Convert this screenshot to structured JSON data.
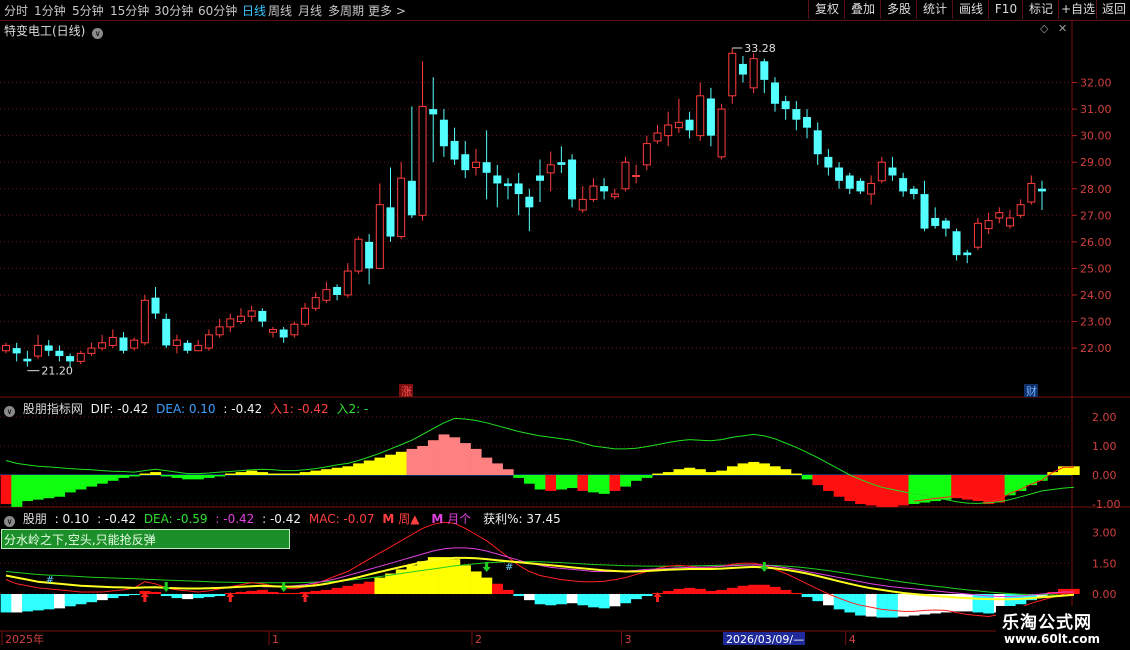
{
  "toolbar": {
    "left_tabs": [
      {
        "label": "分时"
      },
      {
        "label": "1分钟"
      },
      {
        "label": "5分钟"
      },
      {
        "label": "15分钟"
      },
      {
        "label": "30分钟"
      },
      {
        "label": "60分钟"
      },
      {
        "label": "日线",
        "active": true
      },
      {
        "label": "周线"
      },
      {
        "label": "月线"
      },
      {
        "label": "多周期"
      },
      {
        "label": "更多 >"
      }
    ],
    "right_buttons": [
      {
        "label": "复权"
      },
      {
        "label": "叠加"
      },
      {
        "label": "多股"
      },
      {
        "label": "统计"
      },
      {
        "label": "画线"
      },
      {
        "label": "F10"
      },
      {
        "label": "标记"
      },
      {
        "label": "+自选"
      },
      {
        "label": "返回"
      }
    ]
  },
  "main_chart": {
    "title": "特变电工(日线)",
    "y_ticks": [
      "32.00",
      "31.00",
      "30.00",
      "29.00",
      "28.00",
      "27.00",
      "26.00",
      "25.00",
      "24.00",
      "23.00",
      "22.00"
    ],
    "high_label": "33.28",
    "low_label": "21.20",
    "marker_up": "涨",
    "marker_fin": "财",
    "candles": [
      [
        21.9,
        22.1,
        21.8,
        22.2
      ],
      [
        22.0,
        21.8,
        21.5,
        22.2
      ],
      [
        21.6,
        21.5,
        21.3,
        21.9
      ],
      [
        21.7,
        22.1,
        21.6,
        22.5
      ],
      [
        22.1,
        21.9,
        21.7,
        22.3
      ],
      [
        21.9,
        21.7,
        21.5,
        22.1
      ],
      [
        21.7,
        21.5,
        21.3,
        21.8
      ],
      [
        21.5,
        21.8,
        21.4,
        21.9
      ],
      [
        21.8,
        22.0,
        21.7,
        22.2
      ],
      [
        22.0,
        22.2,
        21.9,
        22.5
      ],
      [
        22.1,
        22.4,
        22.0,
        22.7
      ],
      [
        22.4,
        21.9,
        21.8,
        22.6
      ],
      [
        22.0,
        22.3,
        21.9,
        22.4
      ],
      [
        22.2,
        23.8,
        22.1,
        24.0
      ],
      [
        23.9,
        23.3,
        23.1,
        24.3
      ],
      [
        23.1,
        22.1,
        22.0,
        23.3
      ],
      [
        22.1,
        22.3,
        21.8,
        22.5
      ],
      [
        22.2,
        21.9,
        21.8,
        22.3
      ],
      [
        21.9,
        22.1,
        21.9,
        22.3
      ],
      [
        22.0,
        22.5,
        21.9,
        22.7
      ],
      [
        22.5,
        22.8,
        22.4,
        23.1
      ],
      [
        22.8,
        23.1,
        22.6,
        23.3
      ],
      [
        23.0,
        23.2,
        22.9,
        23.5
      ],
      [
        23.2,
        23.4,
        23.0,
        23.6
      ],
      [
        23.4,
        23.0,
        22.8,
        23.5
      ],
      [
        22.6,
        22.7,
        22.4,
        22.8
      ],
      [
        22.7,
        22.4,
        22.2,
        22.8
      ],
      [
        22.5,
        22.9,
        22.4,
        23.0
      ],
      [
        22.9,
        23.5,
        22.8,
        23.7
      ],
      [
        23.5,
        23.9,
        23.4,
        24.1
      ],
      [
        23.8,
        24.2,
        23.7,
        24.5
      ],
      [
        24.3,
        24.0,
        23.8,
        24.4
      ],
      [
        24.0,
        24.9,
        23.9,
        25.2
      ],
      [
        24.9,
        26.1,
        24.8,
        26.2
      ],
      [
        26.0,
        25.0,
        24.4,
        26.3
      ],
      [
        25.0,
        27.4,
        25.0,
        28.2
      ],
      [
        27.3,
        26.2,
        26.0,
        28.8
      ],
      [
        26.2,
        28.4,
        26.1,
        29.0
      ],
      [
        28.3,
        27.0,
        26.9,
        31.1
      ],
      [
        27.0,
        31.1,
        26.8,
        32.8
      ],
      [
        31.0,
        30.8,
        29.0,
        32.2
      ],
      [
        30.6,
        29.6,
        29.2,
        31.0
      ],
      [
        29.8,
        29.1,
        28.9,
        30.3
      ],
      [
        29.3,
        28.7,
        28.4,
        29.8
      ],
      [
        28.8,
        29.0,
        28.5,
        29.5
      ],
      [
        29.0,
        28.6,
        27.6,
        30.2
      ],
      [
        28.5,
        28.2,
        27.3,
        28.9
      ],
      [
        28.2,
        28.1,
        27.6,
        28.4
      ],
      [
        28.2,
        27.8,
        27.0,
        28.6
      ],
      [
        27.7,
        27.3,
        26.4,
        28.0
      ],
      [
        28.5,
        28.3,
        27.5,
        29.1
      ],
      [
        28.6,
        28.9,
        27.9,
        29.4
      ],
      [
        29.0,
        28.9,
        28.6,
        29.6
      ],
      [
        29.1,
        27.6,
        27.3,
        29.3
      ],
      [
        27.2,
        27.6,
        27.1,
        28.1
      ],
      [
        27.6,
        28.1,
        27.5,
        28.4
      ],
      [
        28.1,
        27.9,
        27.6,
        28.4
      ],
      [
        27.7,
        27.8,
        27.6,
        28.0
      ],
      [
        28.0,
        29.0,
        27.9,
        29.2
      ],
      [
        28.5,
        28.5,
        28.2,
        28.9
      ],
      [
        28.9,
        29.7,
        28.7,
        30.0
      ],
      [
        29.8,
        30.1,
        29.7,
        30.4
      ],
      [
        30.0,
        30.4,
        29.6,
        30.9
      ],
      [
        30.3,
        30.5,
        30.1,
        31.4
      ],
      [
        30.6,
        30.2,
        29.9,
        30.9
      ],
      [
        30.0,
        31.5,
        29.8,
        32.0
      ],
      [
        31.4,
        30.0,
        29.6,
        31.8
      ],
      [
        29.2,
        31.0,
        29.1,
        31.2
      ],
      [
        31.5,
        33.1,
        31.2,
        33.3
      ],
      [
        32.7,
        32.3,
        32.0,
        33.0
      ],
      [
        31.8,
        32.9,
        31.6,
        33.1
      ],
      [
        32.8,
        32.1,
        31.6,
        32.9
      ],
      [
        32.0,
        31.2,
        30.9,
        32.2
      ],
      [
        31.3,
        31.0,
        30.6,
        31.5
      ],
      [
        31.0,
        30.6,
        30.2,
        31.3
      ],
      [
        30.7,
        30.3,
        29.9,
        31.0
      ],
      [
        30.2,
        29.3,
        28.9,
        30.5
      ],
      [
        29.2,
        28.8,
        28.5,
        29.5
      ],
      [
        28.8,
        28.3,
        28.0,
        29.0
      ],
      [
        28.5,
        28.0,
        27.8,
        28.6
      ],
      [
        28.3,
        27.9,
        27.8,
        28.4
      ],
      [
        27.8,
        28.2,
        27.4,
        28.5
      ],
      [
        28.3,
        29.0,
        28.2,
        29.2
      ],
      [
        28.8,
        28.5,
        28.3,
        29.2
      ],
      [
        28.4,
        27.9,
        27.7,
        28.6
      ],
      [
        28.0,
        27.8,
        27.6,
        28.1
      ],
      [
        27.8,
        26.5,
        26.4,
        28.3
      ],
      [
        26.9,
        26.6,
        26.5,
        27.3
      ],
      [
        26.8,
        26.5,
        26.2,
        26.9
      ],
      [
        26.4,
        25.5,
        25.3,
        26.5
      ],
      [
        25.6,
        25.5,
        25.2,
        25.7
      ],
      [
        25.8,
        26.7,
        25.7,
        26.9
      ],
      [
        26.5,
        26.8,
        26.3,
        27.1
      ],
      [
        26.9,
        27.1,
        26.7,
        27.3
      ],
      [
        26.6,
        26.9,
        26.5,
        27.2
      ],
      [
        27.0,
        27.4,
        26.9,
        27.6
      ],
      [
        27.5,
        28.2,
        27.4,
        28.5
      ],
      [
        28.0,
        27.9,
        27.2,
        28.3
      ]
    ]
  },
  "macd_panel": {
    "name": "股朋指标网",
    "dif": "DIF: -0.42",
    "dea": "DEA: 0.10",
    "v3": ": -0.42",
    "in1": "入1: -0.42",
    "in2": "入2: -",
    "y_ticks": [
      "2.00",
      "1.00",
      "0.00",
      "-1.00"
    ],
    "hist": [
      -1.0,
      -1.1,
      -0.9,
      -0.85,
      -0.8,
      -0.75,
      -0.6,
      -0.5,
      -0.4,
      -0.3,
      -0.2,
      -0.1,
      -0.05,
      0.05,
      0.1,
      -0.05,
      -0.1,
      -0.15,
      -0.15,
      -0.1,
      -0.05,
      0.05,
      0.1,
      0.15,
      0.1,
      0.05,
      0.05,
      0.05,
      0.1,
      0.15,
      0.2,
      0.25,
      0.3,
      0.4,
      0.5,
      0.6,
      0.7,
      0.8,
      0.9,
      1.0,
      1.2,
      1.4,
      1.3,
      1.1,
      0.9,
      0.6,
      0.4,
      0.2,
      -0.1,
      -0.3,
      -0.5,
      -0.55,
      -0.5,
      -0.45,
      -0.55,
      -0.6,
      -0.65,
      -0.55,
      -0.4,
      -0.2,
      -0.1,
      0.05,
      0.1,
      0.2,
      0.25,
      0.2,
      0.1,
      0.15,
      0.3,
      0.4,
      0.45,
      0.4,
      0.3,
      0.2,
      0.05,
      -0.15,
      -0.35,
      -0.55,
      -0.75,
      -0.9,
      -1.0,
      -1.05,
      -1.1,
      -1.1,
      -1.05,
      -1.0,
      -0.95,
      -0.9,
      -0.85,
      -0.8,
      -0.85,
      -0.9,
      -1.0,
      -0.95,
      -0.7,
      -0.55,
      -0.35,
      -0.2,
      0.1,
      0.3,
      0.3
    ],
    "dif_line": [
      0.5,
      0.4,
      0.35,
      0.3,
      0.28,
      0.25,
      0.22,
      0.2,
      0.18,
      0.15,
      0.13,
      0.12,
      0.1,
      0.15,
      0.2,
      0.15,
      0.1,
      0.05,
      0.05,
      0.07,
      0.1,
      0.12,
      0.15,
      0.18,
      0.2,
      0.18,
      0.15,
      0.15,
      0.18,
      0.22,
      0.28,
      0.35,
      0.4,
      0.5,
      0.62,
      0.75,
      0.9,
      1.05,
      1.2,
      1.4,
      1.6,
      1.8,
      1.95,
      1.93,
      1.88,
      1.8,
      1.7,
      1.6,
      1.5,
      1.42,
      1.35,
      1.3,
      1.25,
      1.2,
      1.1,
      1.0,
      0.95,
      0.9,
      0.9,
      0.92,
      0.98,
      1.05,
      1.12,
      1.18,
      1.22,
      1.2,
      1.18,
      1.22,
      1.3,
      1.35,
      1.4,
      1.35,
      1.25,
      1.1,
      0.95,
      0.78,
      0.6,
      0.4,
      0.2,
      0.0,
      -0.15,
      -0.3,
      -0.42,
      -0.5,
      -0.58,
      -0.65,
      -0.7,
      -0.78,
      -0.85,
      -0.92,
      -0.97,
      -0.98,
      -0.96,
      -0.92,
      -0.85,
      -0.75,
      -0.65,
      -0.55,
      -0.5,
      -0.45,
      -0.42
    ],
    "dea_line": [
      0.05,
      0.05,
      0.05,
      0.05,
      0.05,
      0.05,
      0.05,
      0.05,
      0.05,
      0.05,
      0.05,
      0.05,
      0.05,
      0.05,
      0.05,
      0.05,
      0.05,
      0.05,
      0.05,
      0.05,
      0.05,
      0.05,
      0.05,
      0.05,
      0.05,
      0.05,
      0.05,
      0.05,
      0.05,
      0.05,
      0.05,
      0.05,
      0.05,
      0.05,
      0.05,
      0.05,
      0.05,
      0.05,
      0.05,
      0.05,
      0.05,
      0.05,
      0.05,
      0.05,
      0.05,
      0.05,
      0.05,
      0.05,
      0.05,
      0.05,
      0.05,
      0.05,
      0.05,
      0.05,
      0.05,
      0.05,
      0.05,
      0.05,
      0.05,
      0.05,
      0.05,
      0.05,
      0.05,
      0.05,
      0.05,
      0.05,
      0.05,
      0.05,
      0.05,
      0.05,
      0.05,
      0.05,
      0.05,
      0.05,
      0.05,
      0.05,
      0.05,
      0.05,
      0.05,
      0.05,
      0.05,
      0.05,
      0.05,
      0.05,
      0.05,
      0.05,
      0.05,
      0.05,
      0.05,
      0.05,
      0.05,
      0.05,
      0.05,
      0.05,
      0.05,
      0.05,
      0.05,
      0.05,
      0.05,
      0.05,
      0.05
    ]
  },
  "kdj_panel": {
    "name": "股朋",
    "v1": ": 0.10",
    "v2": ": -0.42",
    "dea": "DEA: -0.59",
    "v4": ": -0.42",
    "v5": ": -0.42",
    "mac": "MAC: -0.07",
    "weekly": "周▲",
    "monthly": "月个",
    "profit": "获利%: 37.45",
    "notice": "分水岭之下,空头,只能抢反弹",
    "y_ticks": [
      "3.00",
      "1.50",
      "0.00"
    ],
    "hist": [
      -0.9,
      -0.9,
      -0.85,
      -0.8,
      -0.75,
      -0.7,
      -0.6,
      -0.5,
      -0.4,
      -0.3,
      -0.2,
      -0.1,
      -0.05,
      0.15,
      0.1,
      -0.1,
      -0.2,
      -0.25,
      -0.2,
      -0.15,
      -0.1,
      0.05,
      0.1,
      0.15,
      0.2,
      0.1,
      0.05,
      0.05,
      0.1,
      0.15,
      0.2,
      0.3,
      0.4,
      0.5,
      0.6,
      0.8,
      1.0,
      1.2,
      1.4,
      1.6,
      1.8,
      1.8,
      1.7,
      1.4,
      1.1,
      0.8,
      0.5,
      0.2,
      -0.1,
      -0.3,
      -0.5,
      -0.55,
      -0.5,
      -0.45,
      -0.55,
      -0.65,
      -0.7,
      -0.6,
      -0.45,
      -0.25,
      -0.1,
      0.05,
      0.15,
      0.25,
      0.3,
      0.25,
      0.15,
      0.2,
      0.3,
      0.4,
      0.45,
      0.45,
      0.35,
      0.2,
      0.05,
      -0.15,
      -0.35,
      -0.55,
      -0.75,
      -0.9,
      -1.05,
      -1.1,
      -1.15,
      -1.15,
      -1.1,
      -1.05,
      -1.0,
      -0.95,
      -0.9,
      -0.85,
      -0.85,
      -0.9,
      -0.95,
      -0.9,
      -0.7,
      -0.5,
      -0.3,
      -0.15,
      0.1,
      0.25,
      0.25
    ],
    "red_line": [
      0.7,
      0.5,
      0.4,
      0.3,
      0.25,
      0.2,
      0.15,
      0.1,
      0.1,
      0.1,
      0.15,
      0.2,
      0.3,
      0.6,
      0.5,
      0.3,
      0.2,
      0.15,
      0.1,
      0.15,
      0.25,
      0.35,
      0.45,
      0.55,
      0.5,
      0.4,
      0.3,
      0.25,
      0.35,
      0.5,
      0.7,
      0.9,
      1.1,
      1.4,
      1.7,
      2.0,
      2.3,
      2.6,
      2.9,
      3.2,
      3.4,
      3.5,
      3.45,
      3.2,
      2.9,
      2.6,
      2.2,
      1.8,
      1.4,
      1.1,
      0.9,
      0.8,
      0.7,
      0.65,
      0.6,
      0.6,
      0.62,
      0.7,
      0.8,
      0.95,
      1.1,
      1.25,
      1.35,
      1.4,
      1.35,
      1.3,
      1.3,
      1.35,
      1.45,
      1.5,
      1.5,
      1.4,
      1.2,
      1.0,
      0.75,
      0.5,
      0.25,
      0.0,
      -0.2,
      -0.4,
      -0.55,
      -0.65,
      -0.75,
      -0.8,
      -0.85,
      -0.85,
      -0.8,
      -0.78,
      -0.8,
      -0.9,
      -1.0,
      -1.05,
      -1.1,
      -1.0,
      -0.85,
      -0.65,
      -0.45,
      -0.3,
      -0.15,
      0.0,
      0.1
    ],
    "magenta_line": [
      null,
      null,
      null,
      null,
      null,
      null,
      null,
      null,
      null,
      null,
      null,
      null,
      null,
      null,
      null,
      null,
      null,
      null,
      null,
      null,
      null,
      null,
      null,
      null,
      0.35,
      0.35,
      0.35,
      0.4,
      0.45,
      0.55,
      0.65,
      0.75,
      0.9,
      1.05,
      1.2,
      1.35,
      1.5,
      1.65,
      1.8,
      1.95,
      2.1,
      2.2,
      2.25,
      2.25,
      2.2,
      2.1,
      1.95,
      1.8,
      1.65,
      1.5,
      1.4,
      1.3,
      1.25,
      1.2,
      1.15,
      1.1,
      1.1,
      1.1,
      1.12,
      1.15,
      1.2,
      1.22,
      1.25,
      1.28,
      1.3,
      1.3,
      1.32,
      1.35,
      1.38,
      1.4,
      1.42,
      1.4,
      1.35,
      1.28,
      1.2,
      1.1,
      1.0,
      0.9,
      0.8,
      0.7,
      0.6,
      0.5,
      0.42,
      0.35,
      0.3,
      0.25,
      0.2,
      0.15,
      0.1,
      0.05,
      0.0,
      -0.05,
      -0.1,
      -0.12,
      -0.12,
      -0.1,
      -0.05,
      0.0,
      0.05,
      0.1,
      0.1
    ],
    "yellow_line": [
      0.9,
      0.8,
      0.7,
      0.6,
      0.55,
      0.5,
      0.45,
      0.4,
      0.38,
      0.35,
      0.33,
      0.32,
      0.3,
      0.32,
      0.33,
      0.3,
      0.28,
      0.27,
      0.27,
      0.28,
      0.3,
      0.32,
      0.35,
      0.38,
      0.4,
      0.38,
      0.36,
      0.35,
      0.38,
      0.42,
      0.5,
      0.6,
      0.7,
      0.82,
      0.95,
      1.08,
      1.2,
      1.32,
      1.44,
      1.55,
      1.65,
      1.72,
      1.76,
      1.76,
      1.74,
      1.7,
      1.65,
      1.6,
      1.55,
      1.5,
      1.45,
      1.4,
      1.35,
      1.3,
      1.25,
      1.2,
      1.15,
      1.12,
      1.1,
      1.1,
      1.12,
      1.15,
      1.18,
      1.2,
      1.22,
      1.22,
      1.22,
      1.24,
      1.27,
      1.3,
      1.32,
      1.3,
      1.25,
      1.18,
      1.1,
      1.0,
      0.88,
      0.75,
      0.62,
      0.5,
      0.38,
      0.28,
      0.2,
      0.12,
      0.05,
      0.0,
      -0.05,
      -0.1,
      -0.13,
      -0.17,
      -0.2,
      -0.23,
      -0.25,
      -0.26,
      -0.26,
      -0.24,
      -0.2,
      -0.16,
      -0.12,
      -0.08,
      -0.04
    ],
    "green_line": [
      1.1,
      1.05,
      1.0,
      0.95,
      0.92,
      0.9,
      0.88,
      0.85,
      0.82,
      0.8,
      0.78,
      0.76,
      0.74,
      0.72,
      0.7,
      0.68,
      0.66,
      0.64,
      0.62,
      0.6,
      0.58,
      0.57,
      0.56,
      0.55,
      0.55,
      0.55,
      0.55,
      0.55,
      0.56,
      0.58,
      0.6,
      0.63,
      0.67,
      0.72,
      0.78,
      0.85,
      0.92,
      1.0,
      1.08,
      1.15,
      1.22,
      1.3,
      1.37,
      1.43,
      1.48,
      1.52,
      1.55,
      1.57,
      1.58,
      1.58,
      1.57,
      1.55,
      1.53,
      1.5,
      1.47,
      1.44,
      1.42,
      1.4,
      1.38,
      1.37,
      1.36,
      1.36,
      1.36,
      1.36,
      1.37,
      1.38,
      1.39,
      1.4,
      1.41,
      1.42,
      1.42,
      1.41,
      1.39,
      1.36,
      1.32,
      1.27,
      1.21,
      1.14,
      1.06,
      0.98,
      0.9,
      0.82,
      0.74,
      0.66,
      0.58,
      0.51,
      0.44,
      0.38,
      0.32,
      0.26,
      0.2,
      0.15,
      0.1,
      0.06,
      0.02,
      -0.01,
      -0.03,
      -0.04,
      -0.05,
      -0.05,
      -0.05
    ]
  },
  "x_axis": {
    "labels": [
      {
        "text": "2025年",
        "bar": 0
      },
      {
        "text": "1",
        "bar": 25
      },
      {
        "text": "2",
        "bar": 44
      },
      {
        "text": "3",
        "bar": 58
      },
      {
        "text": "4",
        "bar": 79
      }
    ],
    "cursor_date": "2026/03/09/—"
  },
  "watermark": {
    "title": "乐淘公式网",
    "url": "www.60lt.com"
  }
}
